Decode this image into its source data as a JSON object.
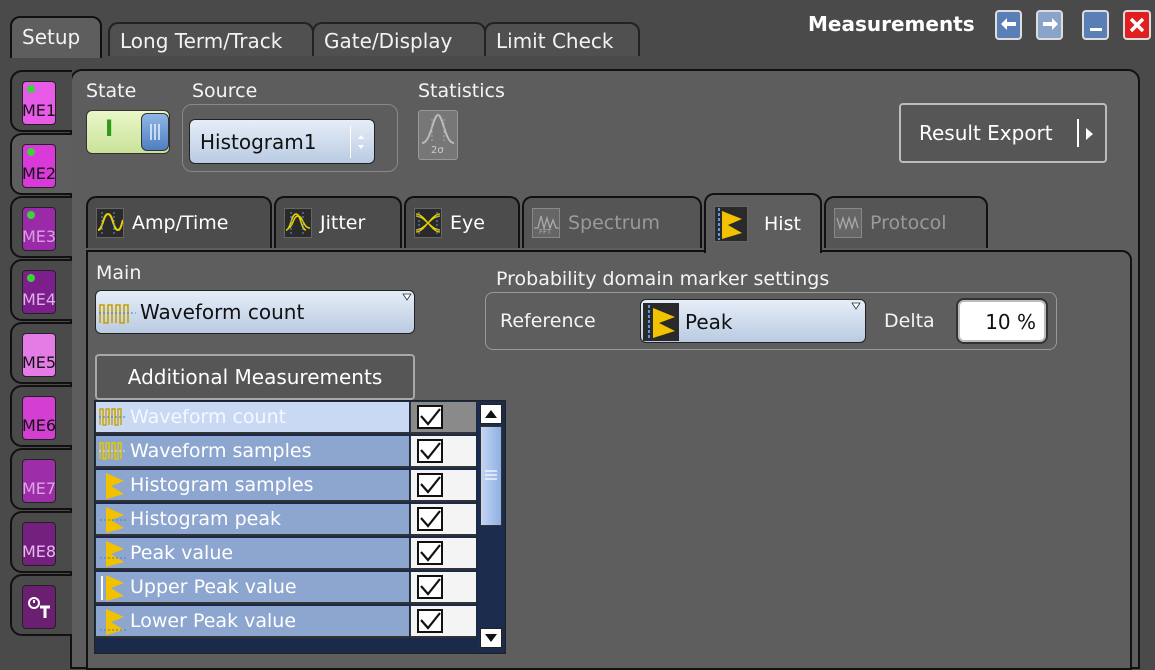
{
  "window": {
    "title": "Measurements"
  },
  "top_tabs": [
    "Setup",
    "Long Term/Track",
    "Gate/Display",
    "Limit Check"
  ],
  "me_tabs": [
    "ME1",
    "ME2",
    "ME3",
    "ME4",
    "ME5",
    "ME6",
    "ME7",
    "ME8"
  ],
  "setup": {
    "state_label": "State",
    "state_on": "I",
    "source_label": "Source",
    "source_value": "Histogram1",
    "statistics_label": "Statistics",
    "statistics_icon_text": "2σ",
    "result_export": "Result Export"
  },
  "sub_tabs": [
    {
      "label": "Amp/Time",
      "enabled": true
    },
    {
      "label": "Jitter",
      "enabled": true
    },
    {
      "label": "Eye",
      "enabled": true
    },
    {
      "label": "Spectrum",
      "enabled": false,
      "icon_text": "FFT"
    },
    {
      "label": "Hist",
      "enabled": true,
      "active": true
    },
    {
      "label": "Protocol",
      "enabled": false
    }
  ],
  "hist": {
    "main_label": "Main",
    "main_value": "Waveform count",
    "prob_label": "Probability domain marker settings",
    "reference_label": "Reference",
    "reference_value": "Peak",
    "delta_label": "Delta",
    "delta_value": "10 %",
    "additional_button": "Additional Measurements",
    "list": [
      {
        "label": "Waveform count",
        "checked": true,
        "selected": true
      },
      {
        "label": "Waveform samples",
        "checked": true
      },
      {
        "label": "Histogram samples",
        "checked": true
      },
      {
        "label": "Histogram peak",
        "checked": true
      },
      {
        "label": "Peak value",
        "checked": true
      },
      {
        "label": "Upper Peak value",
        "checked": true
      },
      {
        "label": "Lower Peak value",
        "checked": true
      }
    ]
  },
  "colors": {
    "accent_blue": "#8da6d0",
    "me_magenta": "#e04ce0",
    "me_purple": "#7a1f8a",
    "close_red": "#e02020"
  }
}
